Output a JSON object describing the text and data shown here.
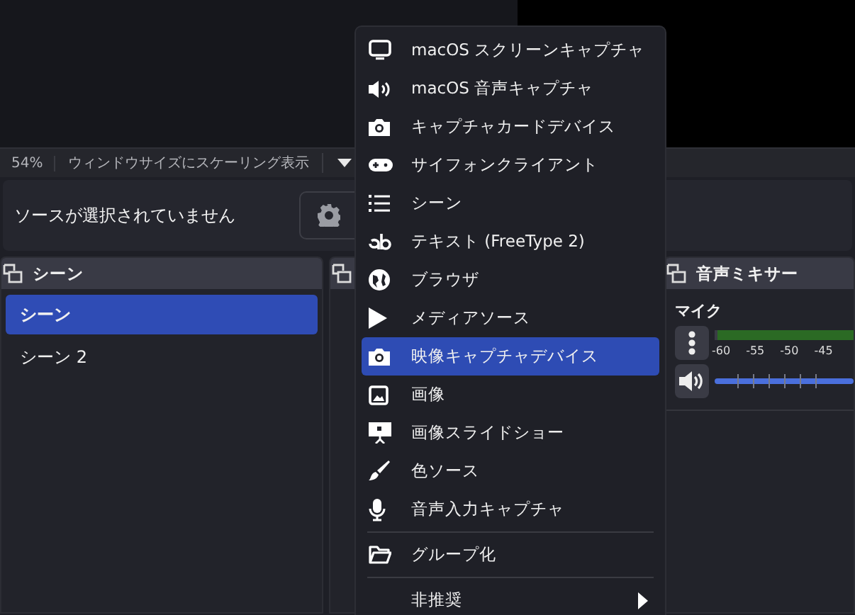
{
  "status": {
    "zoom": "54%",
    "scale_mode": "ウィンドウサイズにスケーリング表示"
  },
  "properties_bar": {
    "message": "ソースが選択されていません"
  },
  "scenes": {
    "title": "シーン",
    "items": [
      {
        "label": "シーン",
        "selected": true
      },
      {
        "label": "シーン 2",
        "selected": false
      }
    ]
  },
  "audio_mixer": {
    "title": "音声ミキサー",
    "channel": "マイク",
    "scale": [
      "-60",
      "-55",
      "-50",
      "-45"
    ],
    "volume": {
      "level": 1
    }
  },
  "context_menu": {
    "items": [
      {
        "kind": "monitor",
        "label": "macOS スクリーンキャプチャ",
        "selected": false
      },
      {
        "kind": "speaker",
        "label": "macOS 音声キャプチャ",
        "selected": false
      },
      {
        "kind": "camera",
        "label": "キャプチャカードデバイス",
        "selected": false
      },
      {
        "kind": "gamepad",
        "label": "サイフォンクライアント",
        "selected": false
      },
      {
        "kind": "list",
        "label": "シーン",
        "selected": false
      },
      {
        "kind": "text",
        "label": "テキスト (FreeType 2)",
        "selected": false
      },
      {
        "kind": "globe",
        "label": "ブラウザ",
        "selected": false
      },
      {
        "kind": "play",
        "label": "メディアソース",
        "selected": false
      },
      {
        "kind": "camera",
        "label": "映像キャプチャデバイス",
        "selected": true
      },
      {
        "kind": "image",
        "label": "画像",
        "selected": false
      },
      {
        "kind": "slideshow",
        "label": "画像スライドショー",
        "selected": false
      },
      {
        "kind": "brush",
        "label": "色ソース",
        "selected": false
      },
      {
        "kind": "mic",
        "label": "音声入力キャプチャ",
        "selected": false
      },
      {
        "kind": "separator"
      },
      {
        "kind": "folder",
        "label": "グループ化",
        "selected": false
      },
      {
        "kind": "separator"
      },
      {
        "kind": "submenu",
        "label": "非推奨",
        "selected": false
      }
    ]
  }
}
